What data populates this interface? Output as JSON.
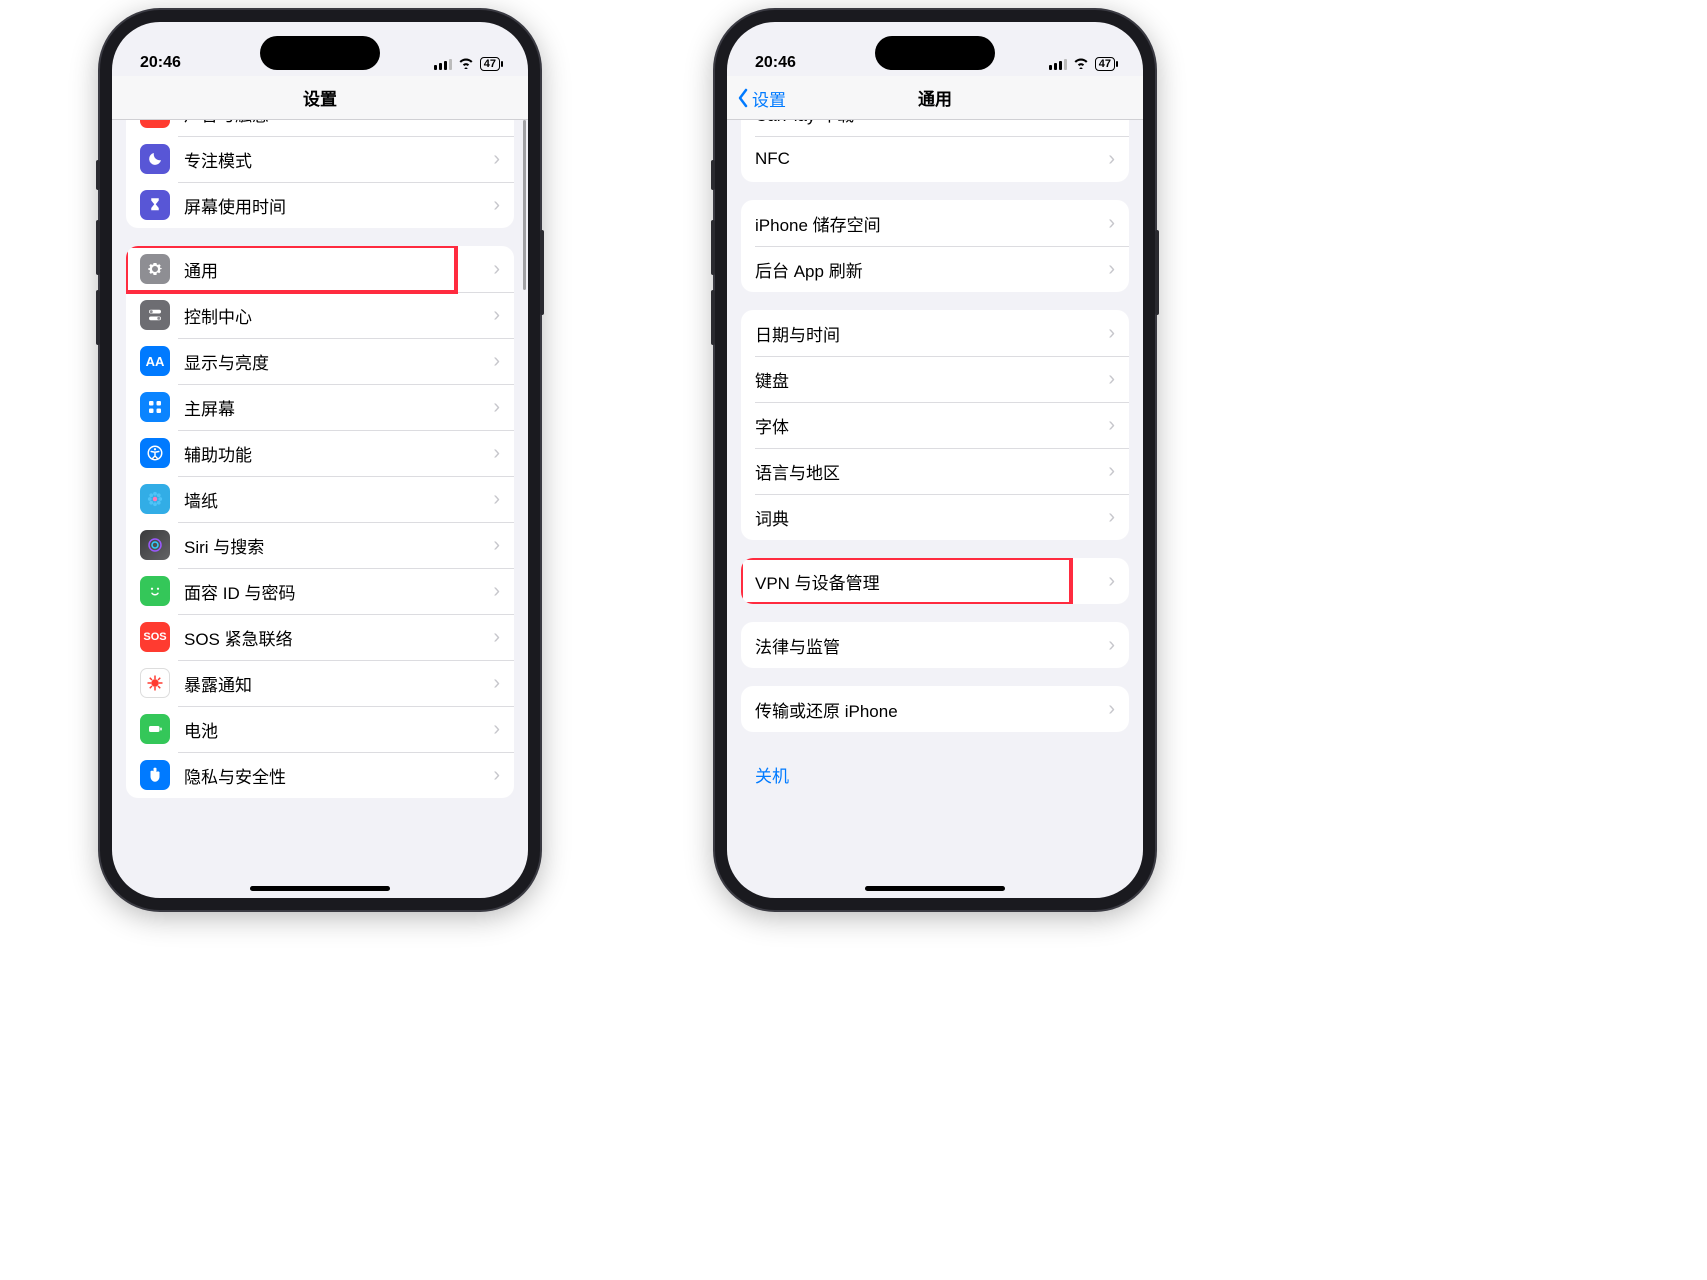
{
  "status": {
    "time": "20:46",
    "battery": "47"
  },
  "left": {
    "title": "设置",
    "groups": [
      {
        "items": [
          {
            "id": "sound",
            "label": "声音与触感",
            "color": "bg-red",
            "icon": "speaker"
          },
          {
            "id": "focus",
            "label": "专注模式",
            "color": "bg-moon",
            "icon": "moon"
          },
          {
            "id": "screentime",
            "label": "屏幕使用时间",
            "color": "bg-indigo",
            "icon": "hourglass"
          }
        ]
      },
      {
        "items": [
          {
            "id": "general",
            "label": "通用",
            "color": "bg-gray",
            "icon": "gear",
            "highlight": true
          },
          {
            "id": "controlcenter",
            "label": "控制中心",
            "color": "bg-darkgray",
            "icon": "switches"
          },
          {
            "id": "display",
            "label": "显示与亮度",
            "color": "bg-blue",
            "icon": "AA"
          },
          {
            "id": "home",
            "label": "主屏幕",
            "color": "bg-blue2",
            "icon": "grid"
          },
          {
            "id": "accessibility",
            "label": "辅助功能",
            "color": "bg-blue",
            "icon": "access"
          },
          {
            "id": "wallpaper",
            "label": "墙纸",
            "color": "bg-cyan",
            "icon": "flower"
          },
          {
            "id": "siri",
            "label": "Siri 与搜索",
            "color": "bg-siri",
            "icon": "siri"
          },
          {
            "id": "faceid",
            "label": "面容 ID 与密码",
            "color": "bg-faceid",
            "icon": "face"
          },
          {
            "id": "sos",
            "label": "SOS 紧急联络",
            "color": "bg-sos",
            "icon": "sos"
          },
          {
            "id": "exposure",
            "label": "暴露通知",
            "color": "bg-covid",
            "icon": "covid"
          },
          {
            "id": "battery",
            "label": "电池",
            "color": "bg-batt",
            "icon": "battery"
          },
          {
            "id": "privacy",
            "label": "隐私与安全性",
            "color": "bg-privacy",
            "icon": "hand"
          }
        ]
      }
    ]
  },
  "right": {
    "back": "设置",
    "title": "通用",
    "groups": [
      {
        "items": [
          {
            "id": "carplay",
            "label": "CarPlay 车载"
          },
          {
            "id": "nfc",
            "label": "NFC"
          }
        ]
      },
      {
        "items": [
          {
            "id": "storage",
            "label": "iPhone 储存空间"
          },
          {
            "id": "bgrefresh",
            "label": "后台 App 刷新"
          }
        ]
      },
      {
        "items": [
          {
            "id": "datetime",
            "label": "日期与时间"
          },
          {
            "id": "keyboard",
            "label": "键盘"
          },
          {
            "id": "fonts",
            "label": "字体"
          },
          {
            "id": "langregion",
            "label": "语言与地区"
          },
          {
            "id": "dict",
            "label": "词典"
          }
        ]
      },
      {
        "items": [
          {
            "id": "vpn",
            "label": "VPN 与设备管理",
            "highlight": true
          }
        ]
      },
      {
        "items": [
          {
            "id": "legal",
            "label": "法律与监管"
          }
        ]
      },
      {
        "items": [
          {
            "id": "transfer",
            "label": "传输或还原 iPhone"
          }
        ]
      }
    ],
    "shutdown": "关机"
  }
}
